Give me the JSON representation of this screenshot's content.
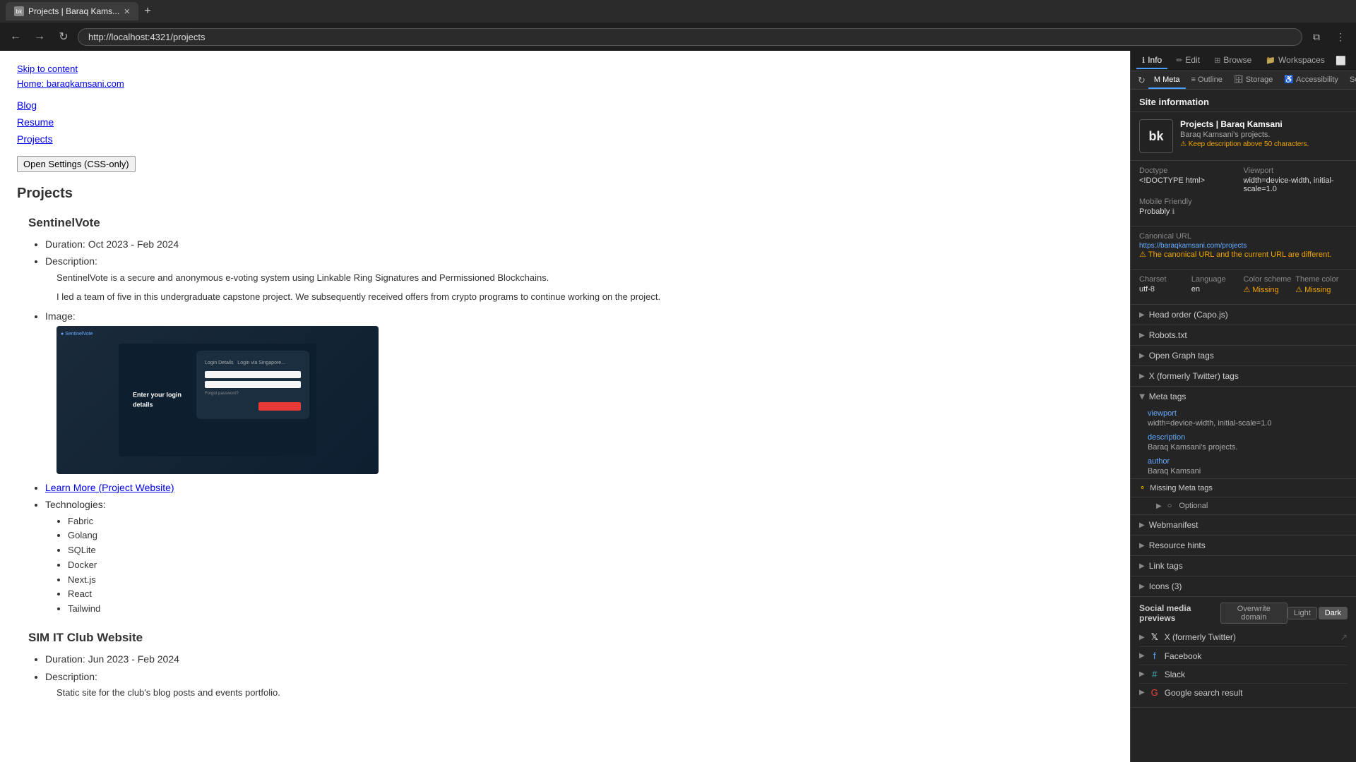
{
  "browser": {
    "tab_title": "Projects | Baraq Kams...",
    "tab_icon": "bk",
    "url": "http://localhost:4321/projects"
  },
  "page": {
    "skip_to_content": "Skip to content",
    "home_link": "Home: baraqkamsani.com",
    "nav_links": [
      "Blog",
      "Resume",
      "Projects"
    ],
    "open_settings_label": "Open Settings (CSS-only)",
    "page_title": "Projects",
    "projects": [
      {
        "name": "SentinelVote",
        "duration": "Duration: Oct 2023 - Feb 2024",
        "description_label": "Description:",
        "desc1": "SentinelVote is a secure and anonymous e-voting system using Linkable Ring Signatures and Permissioned Blockchains.",
        "desc2": "I led a team of five in this undergraduate capstone project. We subsequently received offers from crypto programs to continue working on the project.",
        "image_label": "Image:",
        "learn_more_link": "Learn More (Project Website)",
        "technologies_label": "Technologies:",
        "technologies": [
          "Fabric",
          "Golang",
          "SQLite",
          "Docker",
          "Next.js",
          "React",
          "Tailwind"
        ]
      },
      {
        "name": "SIM IT Club Website",
        "duration": "Duration: Jun 2023 - Feb 2024",
        "description_label": "Description:",
        "desc1": "Static site for the club's blog posts and events portfolio."
      }
    ]
  },
  "devtools": {
    "tabs": [
      {
        "label": "Info",
        "icon": "ℹ",
        "active": true
      },
      {
        "label": "Edit",
        "icon": "✏"
      },
      {
        "label": "Browse",
        "icon": "⊞"
      },
      {
        "label": "Workspaces",
        "icon": "📁"
      }
    ],
    "subtabs": [
      {
        "label": "Meta",
        "icon": "M",
        "active": true
      },
      {
        "label": "Outline",
        "icon": "≡"
      },
      {
        "label": "Storage",
        "icon": "🗄"
      },
      {
        "label": "Accessibility",
        "icon": "♿"
      },
      {
        "label": "Source",
        "icon": "</>"
      }
    ],
    "site_info": {
      "header": "Site information",
      "logo": "bk",
      "title": "Projects | Baraq Kamsani",
      "description": "Baraq Kamsani's projects.",
      "warning": "Keep description above 50 characters.",
      "doctype_label": "Doctype",
      "doctype_value": "<!DOCTYPE html>",
      "viewport_label": "Viewport",
      "viewport_value": "width=device-width, initial-scale=1.0",
      "mobile_friendly_label": "Mobile Friendly",
      "mobile_friendly_value": "Probably",
      "canonical_url_label": "Canonical URL",
      "canonical_url_value": "https://baraqkamsani.com/projects",
      "canonical_url_error": "The canonical URL and the current URL are different.",
      "charset_label": "Charset",
      "charset_value": "utf-8",
      "language_label": "Language",
      "language_value": "en",
      "color_scheme_label": "Color scheme",
      "color_scheme_value": "Missing",
      "theme_color_label": "Theme color",
      "theme_color_value": "Missing"
    },
    "collapsible_sections": [
      {
        "label": "Head order (Capo.js)",
        "open": false
      },
      {
        "label": "Robots.txt",
        "open": false
      },
      {
        "label": "Open Graph tags",
        "open": false
      },
      {
        "label": "X (formerly Twitter) tags",
        "open": false
      }
    ],
    "meta_tags": {
      "header": "Meta tags",
      "expanded": true,
      "items": [
        {
          "key": "viewport",
          "value": "width=device-width, initial-scale=1.0"
        },
        {
          "key": "description",
          "value": "Baraq Kamsani's projects."
        },
        {
          "key": "author",
          "value": "Baraq Kamsani"
        }
      ]
    },
    "missing_meta": {
      "label": "Missing Meta tags"
    },
    "optional": {
      "label": "Optional"
    },
    "collapsible_after": [
      {
        "label": "Webmanifest",
        "open": false
      },
      {
        "label": "Resource hints",
        "open": false
      },
      {
        "label": "Link tags",
        "open": false
      },
      {
        "label": "Icons (3)",
        "open": false
      }
    ],
    "social_preview": {
      "title": "Social media previews",
      "overwrite_domain_label": "Overwrite domain",
      "theme_light": "Light",
      "theme_dark": "Dark",
      "platforms": [
        {
          "name": "X (formerly Twitter)",
          "icon": "𝕏"
        },
        {
          "name": "Facebook",
          "icon": "f"
        },
        {
          "name": "Slack",
          "icon": "#"
        },
        {
          "name": "Google search result",
          "icon": "G"
        }
      ]
    }
  }
}
